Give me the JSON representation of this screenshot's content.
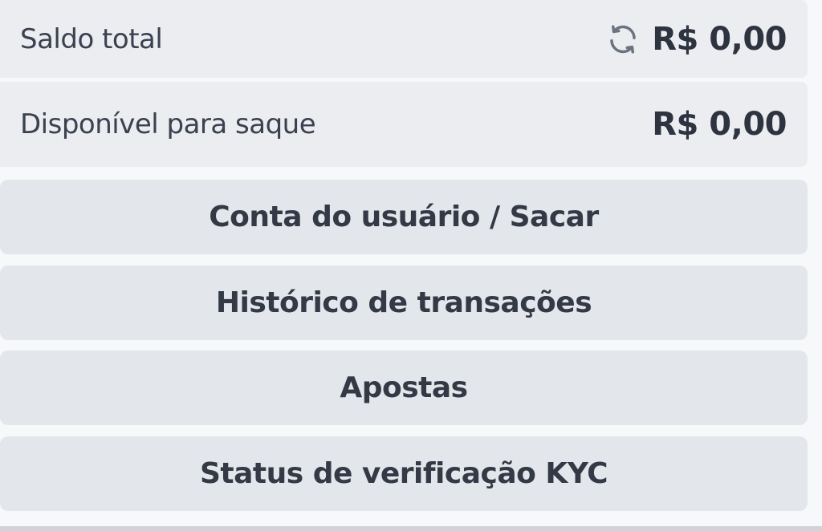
{
  "balance": {
    "label": "Saldo total",
    "value": "R$ 0,00",
    "refresh_icon": "refresh-icon"
  },
  "available": {
    "label": "Disponível para saque",
    "value": "R$ 0,00"
  },
  "menu": {
    "account_label": "Conta do usuário / Sacar",
    "history_label": "Histórico de transações",
    "bets_label": "Apostas",
    "kyc_label": "Status de verificação KYC"
  },
  "colors": {
    "row_bg": "#ebedf0",
    "button_bg": "#e3e6ea",
    "text": "#343946"
  }
}
